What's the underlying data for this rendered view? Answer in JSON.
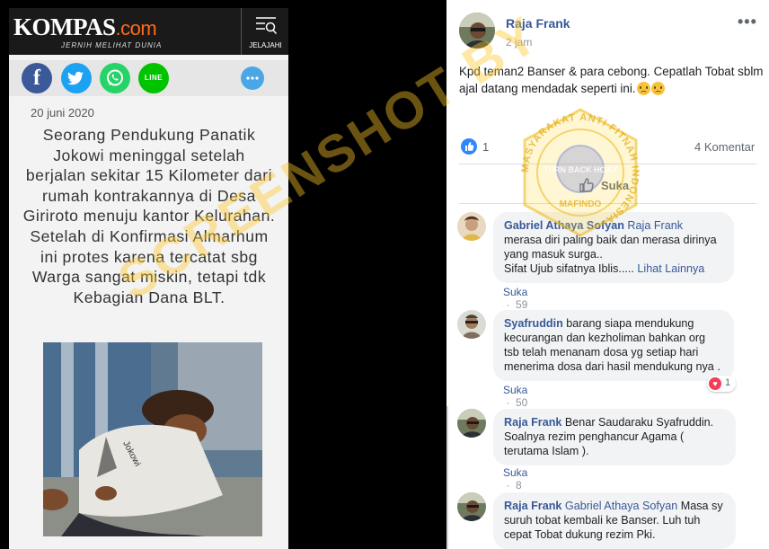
{
  "kompas": {
    "logo_main": "KOMPAS",
    "logo_suffix": ".com",
    "tagline": "JERNIH MELIHAT DUNIA",
    "menu_label": "JELAJAHI",
    "share": {
      "facebook": "f",
      "line": "LINE"
    },
    "date": "20 juni 2020",
    "article_text": "Seorang Pendukung Panatik Jokowi meninggal setelah berjalan sekitar 15 Kilometer dari rumah kontrakannya di Desa Giriroto menuju kantor Kelurahan. Setelah di Konfirmasi Almarhum ini protes karena tercatat sbg Warga sangat miskin, tetapi tdk Kebagian Dana BLT.",
    "photo_caption": "Jokowi"
  },
  "post": {
    "author": "Raja Frank",
    "time": "2 jam",
    "more": "•••",
    "text": "Kpd teman2 Banser & para cebong. Cepatlah Tobat sblm ajal datang mendadak seperti ini.",
    "emoji_count": 2,
    "like_count": "1",
    "comment_count": "4 Komentar",
    "like_button": "Suka"
  },
  "comments": [
    {
      "author": "Gabriel Athaya Sofyan",
      "mention": "Raja Frank",
      "text": "merasa diri paling baik dan merasa dirinya yang masuk surga..",
      "text2": "Sifat Ujub sifatnya Iblis.....",
      "see_more": "Lihat Lainnya",
      "like": "Suka",
      "time": "59 menit"
    },
    {
      "author": "Syafruddin",
      "text": "barang siapa mendukung kecurangan dan kezholiman bahkan org tsb telah menanam dosa yg setiap hari menerima dosa dari hasil mendukung nya .",
      "like": "Suka",
      "time": "50 menit",
      "reaction_count": "1"
    },
    {
      "author": "Raja Frank",
      "text": "Benar Saudaraku Syafruddin. Soalnya rezim penghancur Agama ( terutama Islam ).",
      "like": "Suka",
      "time": "8 menit"
    },
    {
      "author": "Raja Frank",
      "mention": "Gabriel Athaya Sofyan",
      "text": "Masa sy suruh tobat kembali ke Banser. Luh tuh cepat Tobat dukung rezim Pki.",
      "like": "",
      "time": ""
    }
  ],
  "watermark": {
    "text": "SCREENSHOT BY",
    "seal_ring_text": "MASYARAKAT ANTI FITNAH INDONESIA",
    "seal_center": "TURN BACK HOAX",
    "seal_bottom": "MAFINDO"
  },
  "colors": {
    "fb_link": "#385898",
    "kompas_header": "#1a1a1a",
    "kompas_accent": "#ff6a1a",
    "watermark": "#ffc828"
  }
}
